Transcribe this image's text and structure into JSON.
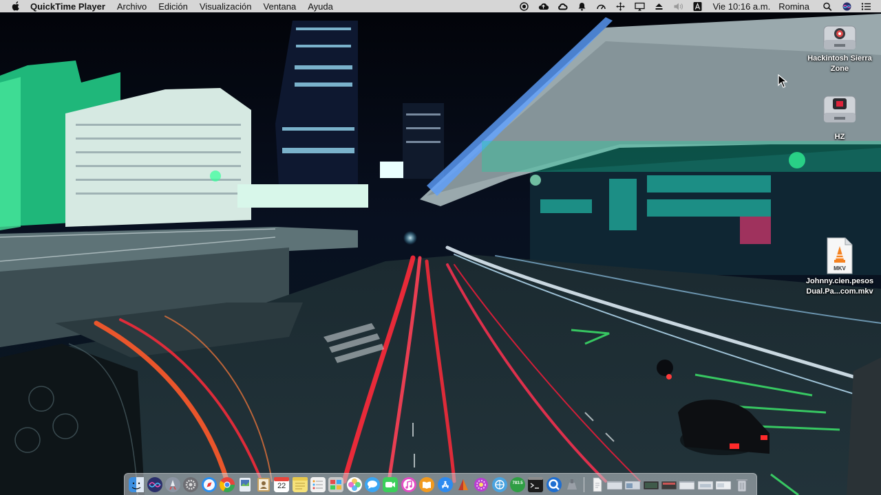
{
  "menubar": {
    "app_name": "QuickTime Player",
    "menus": [
      "Archivo",
      "Edición",
      "Visualización",
      "Ventana",
      "Ayuda"
    ],
    "clock": "Vie 10:16 a.m.",
    "user": "Romina",
    "status_icons": [
      "record-icon",
      "cloud-upload-icon",
      "creative-cloud-icon",
      "notification-bell-icon",
      "speedometer-icon",
      "move-icon",
      "display-mirroring-icon",
      "eject-icon",
      "volume-icon",
      "input-source-icon"
    ]
  },
  "desktop": {
    "icons": [
      {
        "name": "Hackintosh Sierra Zone",
        "line1": "Hackintosh Sierra",
        "line2": "Zone",
        "kind": "usb-drive-icon"
      },
      {
        "name": "HZ",
        "kind": "usb-drive-icon"
      },
      {
        "name": "Johnny.cien.pesos Dual.Pa...com.mkv",
        "line1": "Johnny.cien.pesos",
        "line2": "Dual.Pa...com.mkv",
        "badge": "MKV",
        "kind": "vlc-file-icon"
      }
    ]
  },
  "dock": {
    "apps": [
      {
        "name": "finder-icon",
        "color": "#3d8fe0"
      },
      {
        "name": "siri-icon",
        "color": "#5b3fd6"
      },
      {
        "name": "launchpad-icon",
        "color": "#8c95a3"
      },
      {
        "name": "system-preferences-icon",
        "color": "#6e6e73"
      },
      {
        "name": "safari-icon",
        "color": "#2b8ff0"
      },
      {
        "name": "chrome-icon",
        "color": "#e8453c"
      },
      {
        "name": "preview-icon",
        "color": "#4a76b8"
      },
      {
        "name": "contacts-icon",
        "color": "#c9a15e"
      },
      {
        "name": "calendar-icon",
        "color": "#ffffff",
        "text": "22"
      },
      {
        "name": "notes-icon",
        "color": "#f6e27a"
      },
      {
        "name": "reminders-icon",
        "color": "#f2f2f2"
      },
      {
        "name": "photo-booth-icon",
        "color": "#c9c9c9"
      },
      {
        "name": "photos-icon",
        "color": "#f0b93a"
      },
      {
        "name": "messages-icon",
        "color": "#3aa6f4"
      },
      {
        "name": "facetime-icon",
        "color": "#3ccf5a"
      },
      {
        "name": "itunes-icon",
        "color": "#e34cc4"
      },
      {
        "name": "ibooks-icon",
        "color": "#f29a1f"
      },
      {
        "name": "app-store-icon",
        "color": "#2e8bf0"
      },
      {
        "name": "filezilla-icon",
        "color": "#c0392b"
      },
      {
        "name": "flower-app-icon",
        "color": "#b83fd1"
      },
      {
        "name": "network-app-icon",
        "color": "#4aa3df"
      },
      {
        "name": "stats-app-icon",
        "color": "#2f9e44",
        "text": "783.5"
      },
      {
        "name": "terminal-icon",
        "color": "#1c1c1c"
      },
      {
        "name": "quicktime-icon",
        "color": "#1f6fd1"
      },
      {
        "name": "utility-app-icon",
        "color": "#9aa0a8"
      }
    ],
    "stack_items": [
      {
        "name": "document-icon",
        "color": "#f4f4f4"
      },
      {
        "name": "window-thumbnail-1",
        "color": "#d8dde4"
      },
      {
        "name": "window-thumbnail-2",
        "color": "#cfd6de"
      },
      {
        "name": "window-thumbnail-3",
        "color": "#2d2d2d"
      },
      {
        "name": "window-thumbnail-4",
        "color": "#3a3a3a"
      },
      {
        "name": "window-thumbnail-5",
        "color": "#e4e7eb"
      },
      {
        "name": "window-thumbnail-6",
        "color": "#dfe3e8"
      },
      {
        "name": "window-thumbnail-7",
        "color": "#eceff2"
      },
      {
        "name": "trash-icon",
        "color": "#c7ccd3"
      }
    ]
  }
}
